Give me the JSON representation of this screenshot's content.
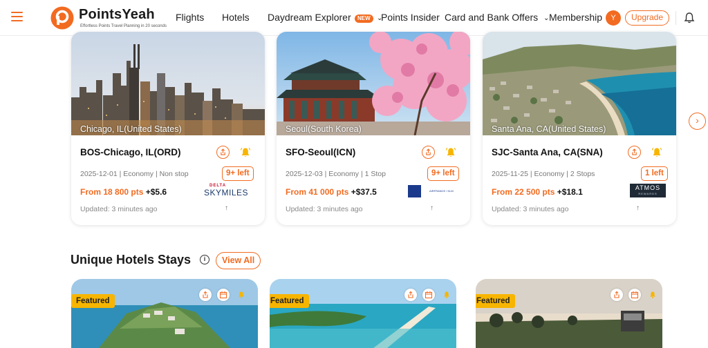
{
  "header": {
    "brand": "PointsYeah",
    "tagline": "Effortless Points Travel Planning in 20 seconds",
    "nav": [
      "Flights",
      "Hotels",
      "Daydream Explorer",
      "Points Insider",
      "Card and Bank Offers",
      "Membership"
    ],
    "new_badge": "NEW",
    "avatar_letter": "Y",
    "upgrade": "Upgrade"
  },
  "flights": [
    {
      "caption": "Chicago, IL(United States)",
      "route": "BOS-Chicago, IL(ORD)",
      "meta": "2025-12-01 | Economy | Non stop",
      "seats_left": "9+ left",
      "price": "From 18 800 pts",
      "tax": "+$5.6",
      "updated": "Updated: 3 minutes ago",
      "airline": "DELTA SKYMILES",
      "airline_top": "DELTA",
      "airline_bottom": "SKYMILES"
    },
    {
      "caption": "Seoul(South Korea)",
      "route": "SFO-Seoul(ICN)",
      "meta": "2025-12-03 | Economy | 1 Stop",
      "seats_left": "9+ left",
      "price": "From 41 000 pts",
      "tax": "+$37.5",
      "updated": "Updated: 3 minutes ago",
      "airline": "FLYING BLUE",
      "airline_small": "AIRFRANCE / KLM"
    },
    {
      "caption": "Santa Ana, CA(United States)",
      "route": "SJC-Santa Ana, CA(SNA)",
      "meta": "2025-11-25 | Economy | 2 Stops",
      "seats_left": "1 left",
      "price": "From 22 500 pts",
      "tax": "+$18.1",
      "updated": "Updated: 3 minutes ago",
      "airline": "ATMOS REWARDS",
      "airline_top": "ATMOS",
      "airline_bottom": "REWARDS"
    }
  ],
  "hotels_section": {
    "title": "Unique Hotels Stays",
    "view_all": "View All",
    "cards": [
      {
        "badge": "Featured"
      },
      {
        "badge": "Featured"
      },
      {
        "badge": "Featured"
      }
    ]
  },
  "colors": {
    "accent": "#f26b21",
    "featured": "#f7b500"
  },
  "icons": [
    "menu-icon",
    "bell-icon",
    "share-icon",
    "info-icon",
    "calendar-icon",
    "chevron-right-icon",
    "arrow-up-icon"
  ]
}
